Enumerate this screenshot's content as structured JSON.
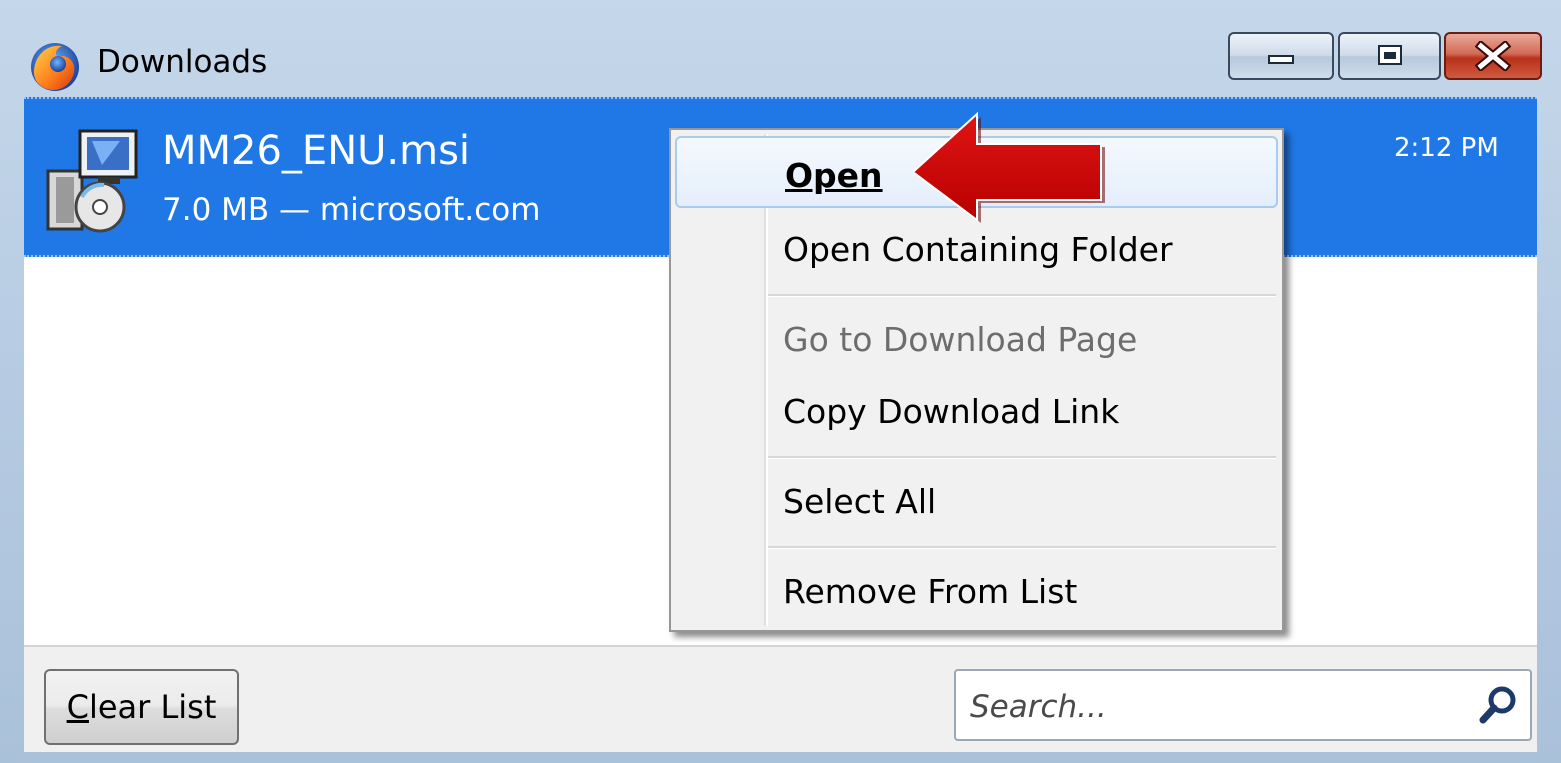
{
  "window": {
    "title": "Downloads",
    "icon": "firefox-icon",
    "controls": [
      "minimize-icon",
      "maximize-icon",
      "close-icon"
    ]
  },
  "download": {
    "file_name": "MM26_ENU.msi",
    "meta": "7.0 MB — microsoft.com",
    "time": "2:12 PM",
    "icon": "msi-installer-icon"
  },
  "context_menu": {
    "items": [
      {
        "label": "Open",
        "accel": "O",
        "state": "highlighted-default"
      },
      {
        "label": "Open Containing Folder",
        "accel": "F",
        "state": "enabled"
      },
      {
        "label": "Go to Download Page",
        "accel": "G",
        "state": "disabled"
      },
      {
        "label": "Copy Download Link",
        "accel": "L",
        "state": "enabled"
      },
      {
        "label": "Select All",
        "accel": "A",
        "state": "enabled"
      },
      {
        "label": "Remove From List",
        "accel": "e",
        "state": "enabled"
      }
    ]
  },
  "bottom": {
    "clear_label": "Clear List",
    "clear_accel": "C",
    "search_placeholder": "Search..."
  },
  "colors": {
    "selection": "#1f78e6",
    "arrow": "#cc0000",
    "window_frame": "#b6cbe2"
  },
  "annotation": {
    "icon": "red-arrow-icon"
  }
}
